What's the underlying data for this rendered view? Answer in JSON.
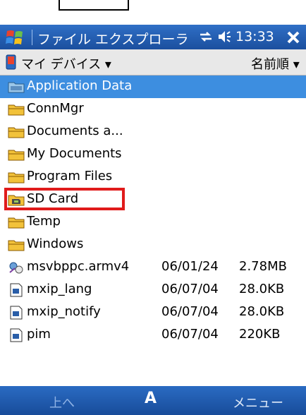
{
  "titlebar": {
    "title": "ファイル エクスプローラ",
    "time": "13:33"
  },
  "nav": {
    "device_label": "マイ デバイス ▾",
    "sort_label": "名前順 ▾"
  },
  "files": [
    {
      "name": "Application Data",
      "date": "",
      "size": "",
      "icon": "system-folder-icon",
      "selected": true
    },
    {
      "name": "ConnMgr",
      "date": "",
      "size": "",
      "icon": "folder-icon"
    },
    {
      "name": "Documents a...",
      "date": "",
      "size": "",
      "icon": "folder-icon"
    },
    {
      "name": "My Documents",
      "date": "",
      "size": "",
      "icon": "folder-icon"
    },
    {
      "name": "Program Files",
      "date": "",
      "size": "",
      "icon": "folder-icon"
    },
    {
      "name": "SD Card",
      "date": "",
      "size": "",
      "icon": "storage-card-icon"
    },
    {
      "name": "Temp",
      "date": "",
      "size": "",
      "icon": "folder-icon"
    },
    {
      "name": "Windows",
      "date": "",
      "size": "",
      "icon": "folder-icon"
    },
    {
      "name": "msvbppc.armv4",
      "date": "06/01/24",
      "size": "2.78MB",
      "icon": "program-file-icon"
    },
    {
      "name": "mxip_lang",
      "date": "06/07/04",
      "size": "28.0KB",
      "icon": "file-icon"
    },
    {
      "name": "mxip_notify",
      "date": "06/07/04",
      "size": "28.0KB",
      "icon": "file-icon"
    },
    {
      "name": "pim",
      "date": "06/07/04",
      "size": "220KB",
      "icon": "file-icon"
    }
  ],
  "softkeys": {
    "left": "上へ",
    "center": "A",
    "right": "メニュー"
  },
  "colors": {
    "titlebar": "#1b4f9e",
    "selection": "#3d8ee0",
    "highlight_box": "#e01b1b",
    "folder": "#f2c23a"
  }
}
